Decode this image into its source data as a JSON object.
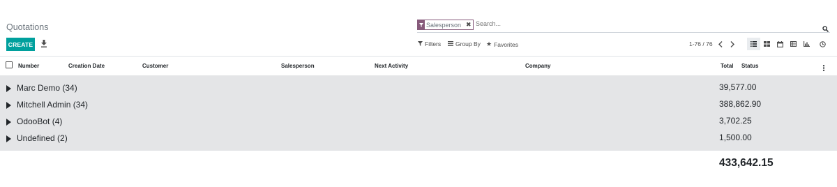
{
  "breadcrumb": {
    "title": "Quotations"
  },
  "toolbar": {
    "create_label": "CREATE",
    "download_icon": "download-icon"
  },
  "search": {
    "facet_icon": "filter-icon",
    "facet_value": "Salesperson",
    "facet_remove_icon": "close-icon",
    "placeholder": "Search...",
    "search_icon": "search-icon"
  },
  "filters": {
    "filters_label": "Filters",
    "group_by_label": "Group By",
    "favorites_label": "Favorites"
  },
  "pager": {
    "value": "1-76 / 76"
  },
  "views": [
    "list",
    "kanban",
    "calendar",
    "pivot",
    "graph",
    "activity"
  ],
  "active_view": "list",
  "table": {
    "columns": {
      "number": "Number",
      "creation_date": "Creation Date",
      "customer": "Customer",
      "salesperson": "Salesperson",
      "next_activity": "Next Activity",
      "company": "Company",
      "total": "Total",
      "status": "Status"
    },
    "groups": [
      {
        "label": "Marc Demo (34)",
        "total": "39,577.00"
      },
      {
        "label": "Mitchell Admin (34)",
        "total": "388,862.90"
      },
      {
        "label": "OdooBot (4)",
        "total": "3,702.25"
      },
      {
        "label": "Undefined (2)",
        "total": "1,500.00"
      }
    ],
    "grand_total": "433,642.15"
  },
  "colors": {
    "accent": "#00a09d",
    "brand": "#875a7b",
    "group_bg": "#e4e5e7"
  }
}
